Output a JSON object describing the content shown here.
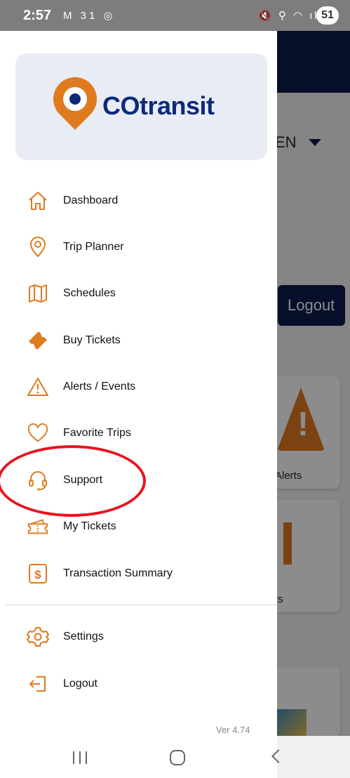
{
  "status_bar": {
    "time": "2:57",
    "left_icons": "M 31 ◎",
    "right_icons": "🔇 ⚲ ◠ ıl",
    "battery": "51"
  },
  "background_app": {
    "language": "EN",
    "logout_label": "Logout",
    "card_alerts_label": "Alerts",
    "card_tickets_label": "ts"
  },
  "drawer": {
    "logo_text": "COtransit",
    "menu": [
      {
        "label": "Dashboard",
        "icon": "home-icon"
      },
      {
        "label": "Trip Planner",
        "icon": "location-pin-icon"
      },
      {
        "label": "Schedules",
        "icon": "map-icon"
      },
      {
        "label": "Buy Tickets",
        "icon": "ticket-icon"
      },
      {
        "label": "Alerts / Events",
        "icon": "warning-icon"
      },
      {
        "label": "Favorite Trips",
        "icon": "heart-icon"
      },
      {
        "label": "Support",
        "icon": "headset-icon"
      },
      {
        "label": "My Tickets",
        "icon": "tickets-icon"
      },
      {
        "label": "Transaction Summary",
        "icon": "dollar-icon"
      }
    ],
    "footer_menu": [
      {
        "label": "Settings",
        "icon": "gear-icon"
      },
      {
        "label": "Logout",
        "icon": "logout-icon"
      }
    ],
    "version": "Ver 4.74"
  },
  "colors": {
    "accent": "#e07a1f",
    "brand": "#0d2a7a",
    "annotation": "#e8141e"
  }
}
